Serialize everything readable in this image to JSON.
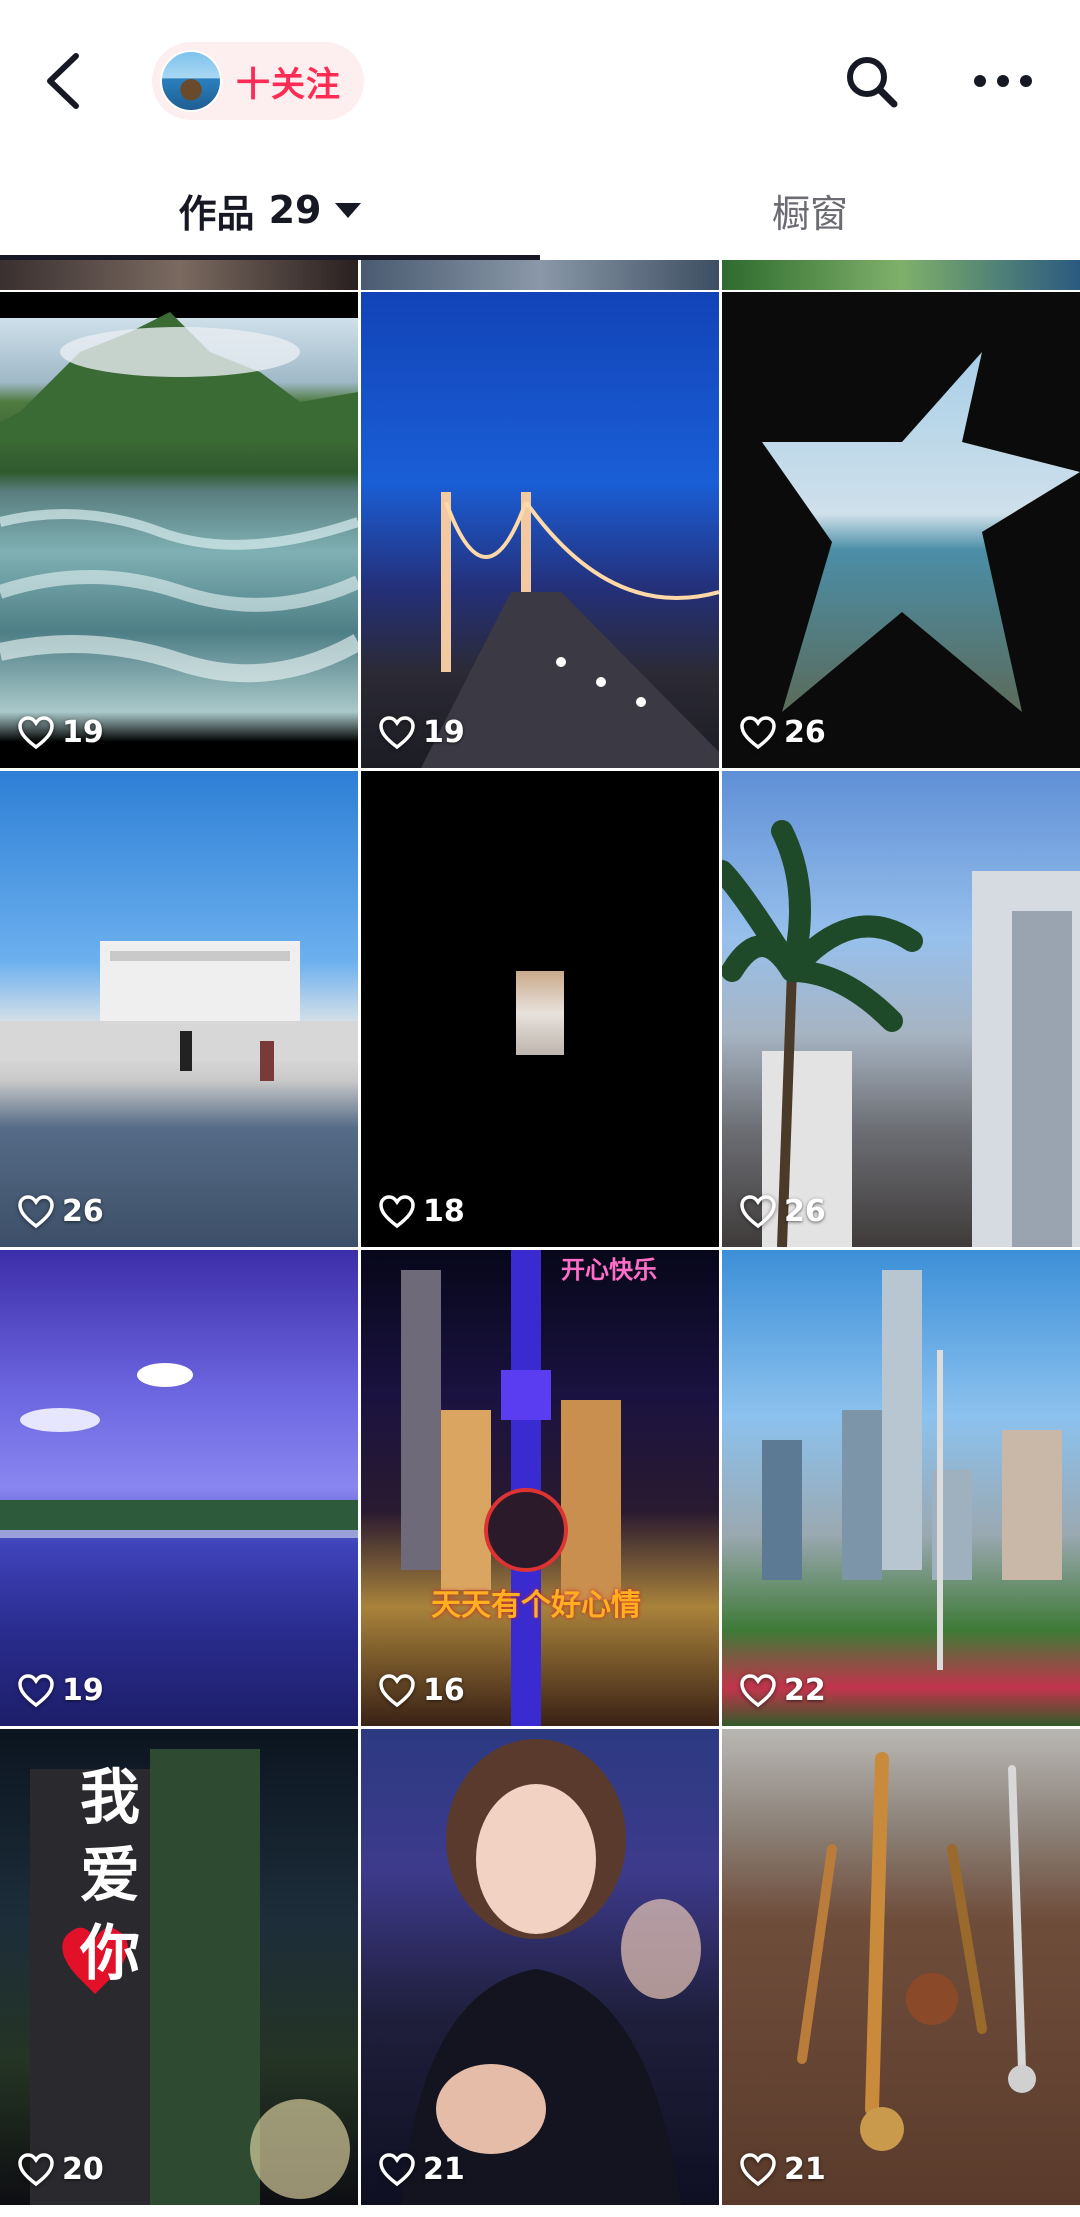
{
  "header": {
    "follow_label": "十关注"
  },
  "tabs": {
    "works_label": "作品",
    "works_count": "29",
    "window_label": "橱窗"
  },
  "grid": {
    "items": [
      {
        "likes": "19",
        "scene": "mountain river"
      },
      {
        "likes": "19",
        "scene": "suspension bridge at night"
      },
      {
        "likes": "26",
        "scene": "star-shaped window onto seaside"
      },
      {
        "likes": "26",
        "scene": "marble pavilion plaza"
      },
      {
        "likes": "18",
        "scene": "black frame with small photo"
      },
      {
        "likes": "26",
        "scene": "palm tree and city buildings"
      },
      {
        "likes": "19",
        "scene": "purple sky over lake"
      },
      {
        "likes": "16",
        "scene": "city tower at night"
      },
      {
        "likes": "22",
        "scene": "skyscrapers and park"
      },
      {
        "likes": "20",
        "scene": "fireworks and skyscraper"
      },
      {
        "likes": "21",
        "scene": "woman portrait on stage"
      },
      {
        "likes": "21",
        "scene": "antique pipes on table"
      }
    ],
    "overlay_texts": {
      "cell8_top": "开心快乐",
      "cell8_middle": "天天有个好心情",
      "cell10_vertical": [
        "我",
        "爱",
        "你"
      ]
    }
  },
  "colors": {
    "accent": "#fe2c55",
    "follow_bg": "#fdeef0",
    "tab_active": "#161823",
    "tab_inactive": "#6b6b73"
  },
  "icons": {
    "back": "chevron-left-icon",
    "search": "search-icon",
    "more": "more-dots-icon",
    "caret": "caret-down-icon",
    "like": "heart-outline-icon"
  }
}
